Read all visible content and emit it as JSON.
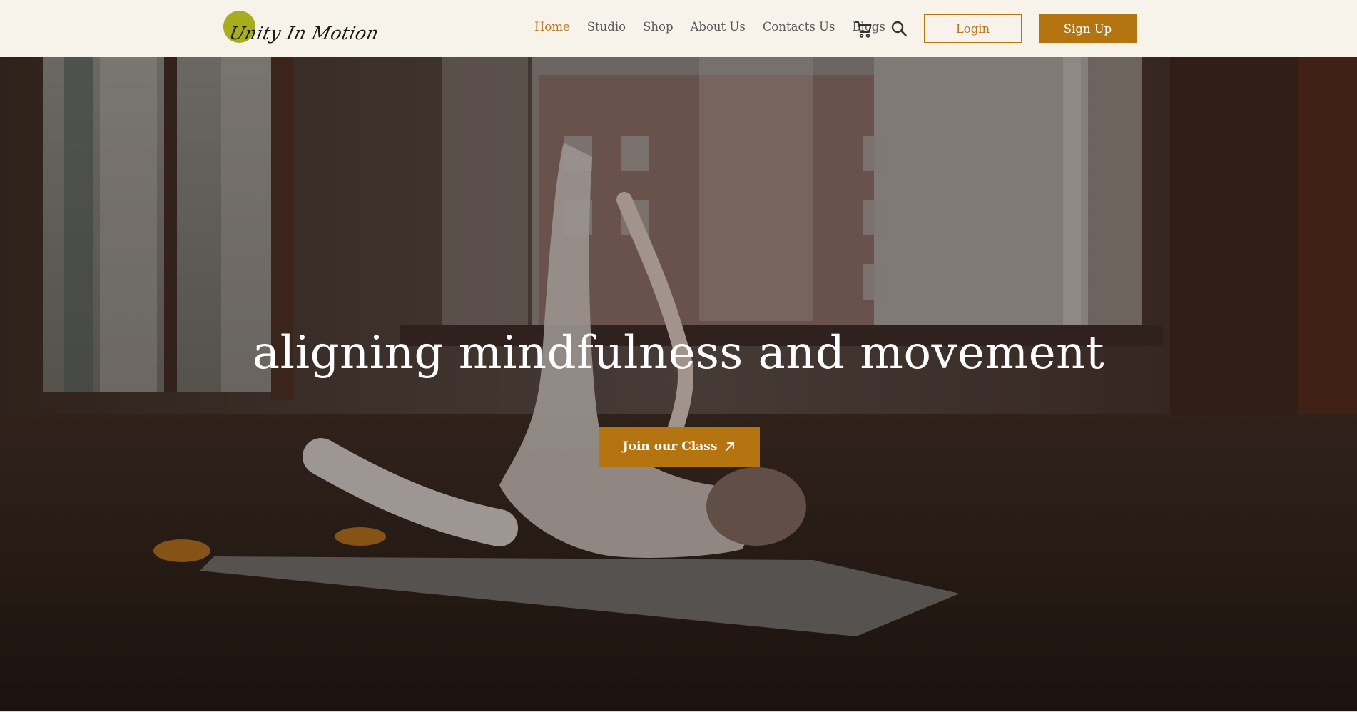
{
  "brand": {
    "name": "Unity In Motion",
    "accent_color": "#b47511",
    "logo_dot_color": "#a7ad1c",
    "nav_background": "#f8f3ea"
  },
  "nav": {
    "items": [
      {
        "label": "Home",
        "active": true
      },
      {
        "label": "Studio",
        "active": false
      },
      {
        "label": "Shop",
        "active": false
      },
      {
        "label": "About Us",
        "active": false
      },
      {
        "label": "Contacts Us",
        "active": false
      },
      {
        "label": "Blogs",
        "active": false
      }
    ],
    "cart_icon": "cart-icon",
    "search_icon": "search-icon",
    "login_label": "Login",
    "signup_label": "Sign Up"
  },
  "hero": {
    "title": "aligning mindfulness and movement",
    "cta_label": "Join our Class",
    "cta_icon": "arrow-up-right-icon",
    "background": "photo of a woman doing a yoga pose on a mat in a studio with large windows"
  }
}
